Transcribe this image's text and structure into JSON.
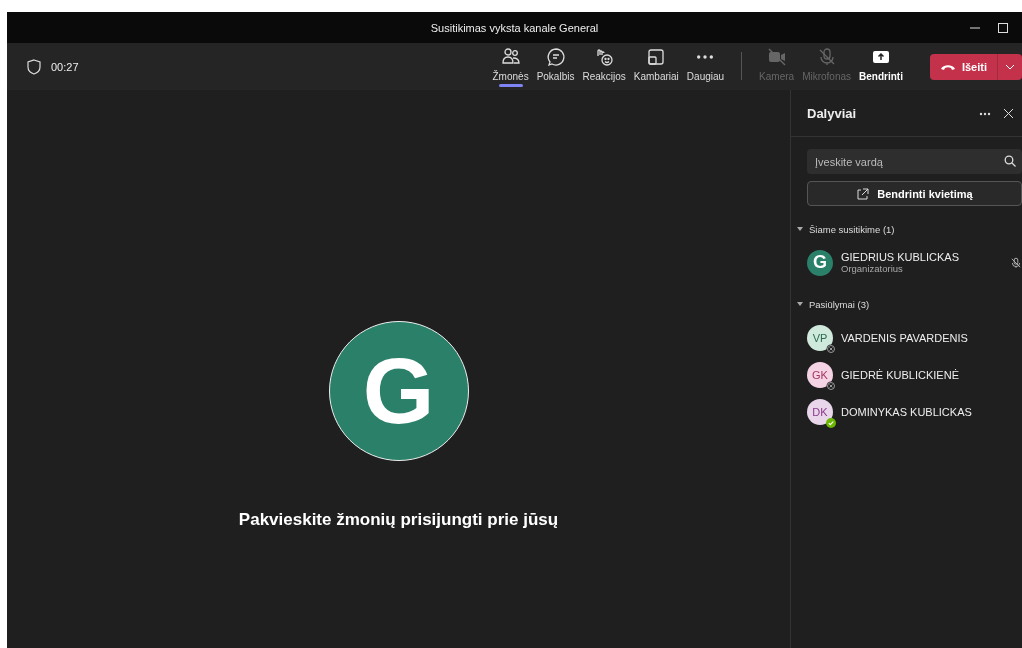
{
  "window": {
    "title": "Susitikimas vyksta kanale General"
  },
  "timer": "00:27",
  "toolbar": [
    {
      "kind": "people",
      "label": "Žmonės",
      "selected": true,
      "disabled": false
    },
    {
      "kind": "chat",
      "label": "Pokalbis",
      "selected": false,
      "disabled": false
    },
    {
      "kind": "react",
      "label": "Reakcijos",
      "selected": false,
      "disabled": false
    },
    {
      "kind": "rooms",
      "label": "Kambariai",
      "selected": false,
      "disabled": false
    },
    {
      "kind": "more",
      "label": "Daugiau",
      "selected": false,
      "disabled": false
    },
    {
      "kind": "camera",
      "label": "Kamera",
      "selected": false,
      "disabled": true
    },
    {
      "kind": "mic",
      "label": "Mikrofonas",
      "selected": false,
      "disabled": true
    },
    {
      "kind": "share",
      "label": "Bendrinti",
      "selected": false,
      "disabled": false
    }
  ],
  "leave_button": "Išeiti",
  "stage": {
    "avatar_letter": "G",
    "message": "Pakvieskite žmonių prisijungti prie jūsų"
  },
  "panel": {
    "title": "Dalyviai",
    "search": {
      "placeholder": "Įveskite vardą"
    },
    "invite_button": "Bendrinti kvietimą",
    "sections": [
      {
        "title": "Šiame susitikime (1)",
        "expanded": true,
        "people": [
          {
            "initials": "G",
            "name": "GIEDRIUS KUBLICKAS",
            "role": "Organizatorius",
            "color": "#2a8069",
            "kind": "organizer",
            "muted": true
          }
        ]
      },
      {
        "title": "Pasiūlymai (3)",
        "expanded": true,
        "people": [
          {
            "initials": "VP",
            "name": "VARDENIS PAVARDENIS",
            "color": "#cfe9dc",
            "kind": "offline",
            "muted": false
          },
          {
            "initials": "GK",
            "name": "GIEDRĖ KUBLICKIENĖ",
            "color": "#f4d4e4",
            "kind": "offline",
            "muted": false
          },
          {
            "initials": "DK",
            "name": "DOMINYKAS KUBLICKAS",
            "color": "#ead6ea",
            "kind": "available",
            "muted": false
          }
        ]
      }
    ]
  }
}
